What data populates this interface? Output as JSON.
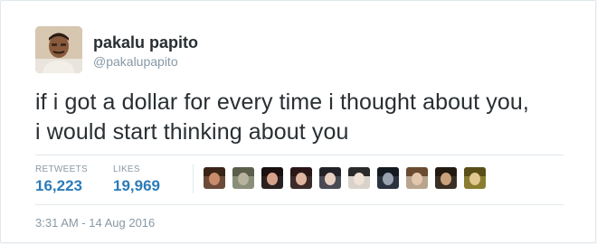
{
  "user": {
    "display_name": "pakalu papito",
    "handle": "@pakalupapito",
    "avatar_icon": "user-photo-avatar"
  },
  "tweet": {
    "line1": "if i got a dollar for every time i thought about you,",
    "line2": "i would start thinking about you"
  },
  "stats": {
    "retweets_label": "RETWEETS",
    "retweets_value": "16,223",
    "likes_label": "LIKES",
    "likes_value": "19,969"
  },
  "facepile": [
    {
      "bg": "#6b4a3a",
      "hair": "#3a2418",
      "skin": "#c98c6a"
    },
    {
      "bg": "#8a8f7a",
      "hair": "#5a5e4a",
      "skin": "#b7b39e"
    },
    {
      "bg": "#2a2222",
      "hair": "#1a1010",
      "skin": "#d6a28a"
    },
    {
      "bg": "#3d2a2a",
      "hair": "#2a1616",
      "skin": "#e0b6a0"
    },
    {
      "bg": "#4a4a55",
      "hair": "#222228",
      "skin": "#e8d0c0"
    },
    {
      "bg": "#d9d2ca",
      "hair": "#2a2a2a",
      "skin": "#f0e2d6"
    },
    {
      "bg": "#2b3340",
      "hair": "#151a22",
      "skin": "#9aa2b0"
    },
    {
      "bg": "#b9a48e",
      "hair": "#6a4b30",
      "skin": "#e3c7ac"
    },
    {
      "bg": "#3a2f24",
      "hair": "#231a12",
      "skin": "#c9a27c"
    },
    {
      "bg": "#8a7d30",
      "hair": "#5a4e18",
      "skin": "#e0c890"
    }
  ],
  "timestamp": "3:31 AM - 14 Aug 2016",
  "colors": {
    "accent": "#2b7bb9",
    "muted": "#8899a6",
    "text": "#292f33",
    "border": "#e1e8ed"
  }
}
